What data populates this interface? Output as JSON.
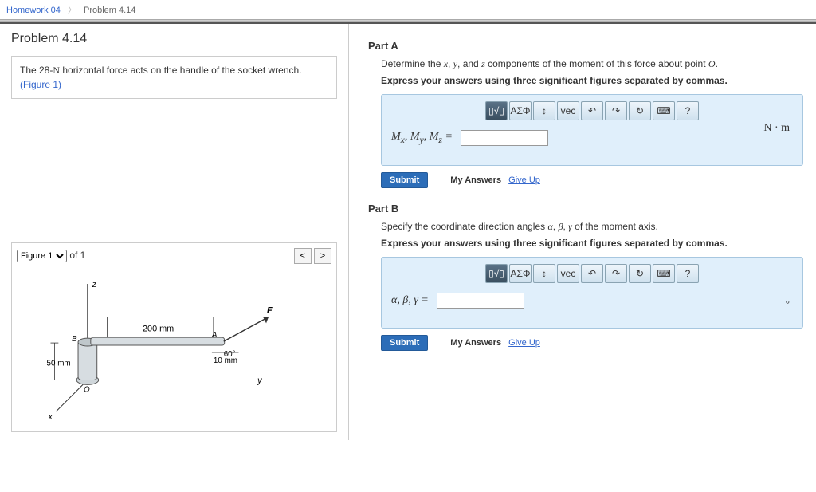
{
  "breadcrumb": {
    "hw": "Homework 04",
    "prob": "Problem 4.14"
  },
  "title": "Problem 4.14",
  "statement": {
    "text1": "The 28-",
    "unitN": "N",
    "text2": " horizontal force acts on the handle of the socket wrench.",
    "figlink": "(Figure 1)"
  },
  "figure": {
    "label": "Figure 1",
    "count": "of 1",
    "dims": {
      "d200": "200 mm",
      "d10": "10 mm",
      "d50": "50 mm",
      "ang": "60°"
    },
    "axes": {
      "x": "x",
      "y": "y",
      "z": "z"
    },
    "pts": {
      "A": "A",
      "B": "B",
      "O": "O",
      "F": "F"
    }
  },
  "partA": {
    "header": "Part A",
    "prompt1": "Determine the ",
    "vx": "x",
    "vy": "y",
    "vz": "z",
    "prompt2": " components of the moment of this force about point ",
    "ptO": "O",
    "prompt3": ".",
    "instruct": "Express your answers using three significant figures separated by commas.",
    "lhs": "Mₓ, Mᵧ, M𝓏 =",
    "units": "N · m",
    "submit": "Submit",
    "myans": "My Answers",
    "giveup": "Give Up"
  },
  "partB": {
    "header": "Part B",
    "prompt1": "Specify the coordinate direction angles ",
    "va": "α",
    "vb": "β",
    "vg": "γ",
    "prompt2": " of the moment axis.",
    "instruct": "Express your answers using three significant figures separated by commas.",
    "lhs": "α, β, γ =",
    "units": "°",
    "submit": "Submit",
    "myans": "My Answers",
    "giveup": "Give Up"
  },
  "toolbar": {
    "templates": "▯√▯",
    "greek": "ΑΣΦ",
    "subsup": "↕",
    "vec": "vec",
    "undo": "↶",
    "redo": "↷",
    "reset": "↻",
    "keyboard": "⌨",
    "help": "?"
  }
}
